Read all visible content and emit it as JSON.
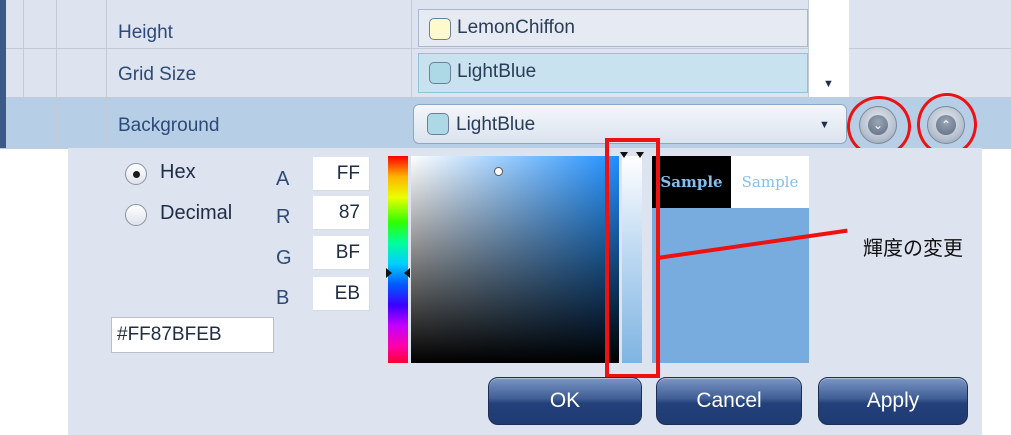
{
  "properties": {
    "height": {
      "label": "Height",
      "value": "LemonChiffon",
      "swatch": "#fffacd"
    },
    "grid_size": {
      "label": "Grid Size",
      "value": "LightBlue",
      "swatch": "#add8e6"
    },
    "background": {
      "label": "Background",
      "value": "LightBlue",
      "swatch": "#add8e6"
    }
  },
  "buttons": {
    "expand": "chevron-down-icon",
    "collapse": "chevron-up-icon"
  },
  "format": {
    "hex_label": "Hex",
    "decimal_label": "Decimal",
    "selected": "Hex"
  },
  "channels": [
    {
      "label": "A",
      "value": "FF"
    },
    {
      "label": "R",
      "value": "87"
    },
    {
      "label": "G",
      "value": "BF"
    },
    {
      "label": "B",
      "value": "EB"
    }
  ],
  "hex_value": "#FF87BFEB",
  "sample": {
    "dark_text": "Sample",
    "light_text": "Sample",
    "preview_color": "#87bfeb"
  },
  "annotation": "輝度の変更",
  "dialog_buttons": {
    "ok": "OK",
    "cancel": "Cancel",
    "apply": "Apply"
  }
}
